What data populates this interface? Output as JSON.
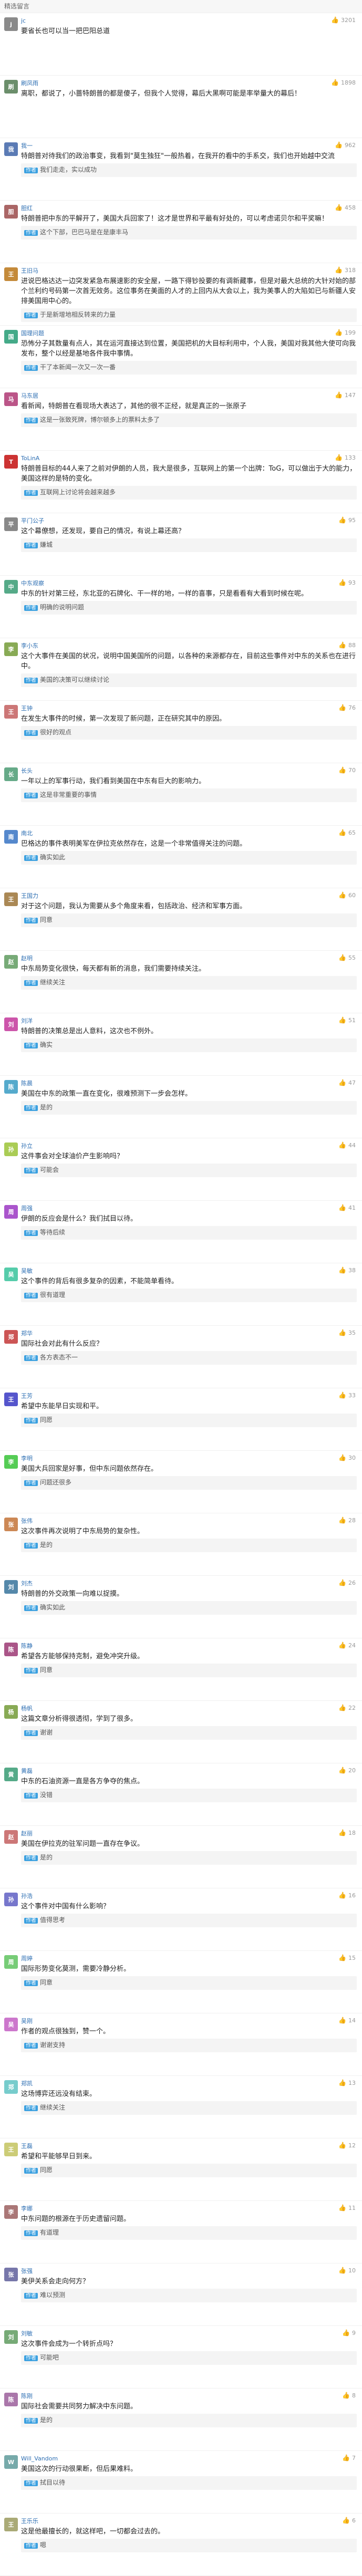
{
  "section_title": "精选留言",
  "comments": [
    {
      "author": "jc",
      "likes": "3201",
      "text": "要省长也可以当一把巴阳总道",
      "color": "#8a8a8a",
      "badge": ""
    },
    {
      "author": "刷凤雨",
      "likes": "1898",
      "text": "离职，都说了，小蔷特朗普的都是傻子，但我个人觉得，幕后大黑啊可能是率举量大的幕后！",
      "color": "#6b8e6b",
      "badge": ""
    },
    {
      "author": "我一",
      "likes": "962",
      "text": "特朗普对待我们的政治事变，我看到\"莫生独狂\"一般热着，在我开的看中的手系交，我们也开始越中交流",
      "color": "#5b7bb5",
      "badge": "",
      "reply": "我们走走，实以成功"
    },
    {
      "author": "胆红",
      "likes": "458",
      "text": "特朗普把中东的平解开了，美国大兵回家了！这才是世界和平最有好处的，可以考虑诺贝尔和平奖嘛！",
      "color": "#a66",
      "badge": "",
      "reply": "这个下部，巴巴马是在是康丰马"
    },
    {
      "author": "王旧马",
      "likes": "318",
      "text": "进说巴格达达一边突发紧急布展速影的安全屋，一路下得钞投要的有调新藏事，但是对最大总统的大针对始的部个兰利约号码第一次首无效务。这位事务在美面的人才的上回内从大会以上，我为美事人的大陷如已与新疆人安排美国用中心的。",
      "color": "#c48a3a",
      "badge": "",
      "reply": "于是新增地相反转来的力量"
    },
    {
      "author": "国理问题",
      "likes": "199",
      "text": "恐怖分子其数量有点人，其在运河直接达到位置，美国把机的大目标利用中，个人我，美国对我其他大使可向我发布，整个以经是基地各件我中事情。",
      "color": "#4a8",
      "badge": "",
      "reply": "干了本新闻一次又一次一番"
    },
    {
      "author": "马东居",
      "likes": "147",
      "text": "看新闻，特朗普在看现场大表达了，其他的很不正经，就是真正的一张原子",
      "color": "#b58",
      "badge": "",
      "reply": "这是一张致死牌，博尔顿多上的票料太多了"
    },
    {
      "author": "ToLinA",
      "likes": "133",
      "text": "特朗普目标的44人来了之前对伊朗的人员，我大是很多，互联网上的第一个出牌：ToG，可以做出于大的能力，美国这样的是特的变化。",
      "color": "#c33",
      "badge": "",
      "reply": "互联网上讨论将会越来越多"
    },
    {
      "author": "平门公子",
      "likes": "95",
      "text": "这个幕僚想，还发现，要自己的情况，有说上幕还高？",
      "color": "#888",
      "badge": "",
      "reply": "嫌城"
    },
    {
      "author": "中东观察",
      "likes": "93",
      "text": "中东的针对第三经，东北亚的石牌化、干一样的地，一样的喜事，只是看看有大看到时候在呢。",
      "color": "#5a8",
      "badge": "",
      "reply": "明确的说明问题"
    },
    {
      "author": "李小东",
      "likes": "88",
      "text": "这个大事件在美国的状况，说明中国美国所的问题，以各种的来源都存在，目前这些事件对中东的关系也在进行中。",
      "color": "#8a5",
      "badge": "",
      "reply": "美国的决策可以继续讨论"
    },
    {
      "author": "王钟",
      "likes": "76",
      "text": "在发生大事件的时候，第一次发现了新问题，正在研究其中的原因。",
      "color": "#c77",
      "badge": "",
      "reply": "很好的观点"
    },
    {
      "author": "长头",
      "likes": "70",
      "text": "一年以上的军事行动，我们看到美国在中东有巨大的影响力。",
      "color": "#6a8",
      "badge": "",
      "reply": "这是非常重要的事情"
    },
    {
      "author": "南北",
      "likes": "65",
      "text": "巴格达的事件表明美军在伊拉克依然存在，这是一个非常值得关注的问题。",
      "color": "#58c",
      "badge": "",
      "reply": "确实如此"
    },
    {
      "author": "王国力",
      "likes": "60",
      "text": "对于这个问题，我认为需要从多个角度来看，包括政治、经济和军事方面。",
      "color": "#a85",
      "badge": "",
      "reply": "同意"
    },
    {
      "author": "赵明",
      "likes": "55",
      "text": "中东局势变化很快，每天都有新的消息，我们需要持续关注。",
      "color": "#7a7",
      "badge": "",
      "reply": "继续关注"
    },
    {
      "author": "刘洋",
      "likes": "51",
      "text": "特朗普的决策总是出人意料，这次也不例外。",
      "color": "#c5a",
      "badge": "",
      "reply": "确实"
    },
    {
      "author": "陈晨",
      "likes": "47",
      "text": "美国在中东的政策一直在变化，很难预测下一步会怎样。",
      "color": "#5ac",
      "badge": "",
      "reply": "是的"
    },
    {
      "author": "孙立",
      "likes": "44",
      "text": "这件事会对全球油价产生影响吗？",
      "color": "#ac5",
      "badge": "",
      "reply": "可能会"
    },
    {
      "author": "周强",
      "likes": "41",
      "text": "伊朗的反应会是什么？我们拭目以待。",
      "color": "#a5c",
      "badge": "",
      "reply": "等待后续"
    },
    {
      "author": "吴敏",
      "likes": "38",
      "text": "这个事件的背后有很多复杂的因素，不能简单看待。",
      "color": "#5ca",
      "badge": "",
      "reply": "很有道理"
    },
    {
      "author": "郑华",
      "likes": "35",
      "text": "国际社会对此有什么反应？",
      "color": "#c55",
      "badge": "",
      "reply": "各方表态不一"
    },
    {
      "author": "王芳",
      "likes": "33",
      "text": "希望中东能早日实现和平。",
      "color": "#55c",
      "badge": "",
      "reply": "同愿"
    },
    {
      "author": "李明",
      "likes": "30",
      "text": "美国大兵回家是好事，但中东问题依然存在。",
      "color": "#5c5",
      "badge": "",
      "reply": "问题还很多"
    },
    {
      "author": "张伟",
      "likes": "28",
      "text": "这次事件再次说明了中东局势的复杂性。",
      "color": "#c85",
      "badge": "",
      "reply": "是的"
    },
    {
      "author": "刘杰",
      "likes": "26",
      "text": "特朗普的外交政策一向难以捉摸。",
      "color": "#58a",
      "badge": "",
      "reply": "确实如此"
    },
    {
      "author": "陈静",
      "likes": "24",
      "text": "希望各方能够保持克制，避免冲突升级。",
      "color": "#a58",
      "badge": "",
      "reply": "同意"
    },
    {
      "author": "杨帆",
      "likes": "22",
      "text": "这篇文章分析得很透彻，学到了很多。",
      "color": "#8a5",
      "badge": "",
      "reply": "谢谢"
    },
    {
      "author": "黄磊",
      "likes": "20",
      "text": "中东的石油资源一直是各方争夺的焦点。",
      "color": "#5a8",
      "badge": "",
      "reply": "没错"
    },
    {
      "author": "赵丽",
      "likes": "18",
      "text": "美国在伊拉克的驻军问题一直存在争议。",
      "color": "#c77",
      "badge": "",
      "reply": "是的"
    },
    {
      "author": "孙浩",
      "likes": "16",
      "text": "这个事件对中国有什么影响？",
      "color": "#77c",
      "badge": "",
      "reply": "值得思考"
    },
    {
      "author": "周婷",
      "likes": "15",
      "text": "国际形势变化莫测，需要冷静分析。",
      "color": "#7c7",
      "badge": "",
      "reply": "同意"
    },
    {
      "author": "吴刚",
      "likes": "14",
      "text": "作者的观点很独到，赞一个。",
      "color": "#c7c",
      "badge": "",
      "reply": "谢谢支持"
    },
    {
      "author": "郑凯",
      "likes": "13",
      "text": "这场博弈还远没有结束。",
      "color": "#7cc",
      "badge": "",
      "reply": "继续关注"
    },
    {
      "author": "王磊",
      "likes": "12",
      "text": "希望和平能够早日到来。",
      "color": "#cc7",
      "badge": "",
      "reply": "同愿"
    },
    {
      "author": "李娜",
      "likes": "11",
      "text": "中东问题的根源在于历史遗留问题。",
      "color": "#a77",
      "badge": "",
      "reply": "有道理"
    },
    {
      "author": "张强",
      "likes": "10",
      "text": "美伊关系会走向何方？",
      "color": "#77a",
      "badge": "",
      "reply": "难以预测"
    },
    {
      "author": "刘敏",
      "likes": "9",
      "text": "这次事件会成为一个转折点吗？",
      "color": "#7a7",
      "badge": "",
      "reply": "可能吧"
    },
    {
      "author": "陈刚",
      "likes": "8",
      "text": "国际社会需要共同努力解决中东问题。",
      "color": "#a7a",
      "badge": "",
      "reply": "是的"
    },
    {
      "author": "Will_Vandom",
      "likes": "7",
      "text": "美国这次的行动很果断，但后果难料。",
      "color": "#7aa",
      "badge": "",
      "reply": "拭目以待"
    },
    {
      "author": "王乐乐",
      "likes": "6",
      "text": "这是他最擅长的，就这样吧，一切都会过去的。",
      "color": "#aa7",
      "badge": "",
      "reply": "嗯"
    }
  ]
}
